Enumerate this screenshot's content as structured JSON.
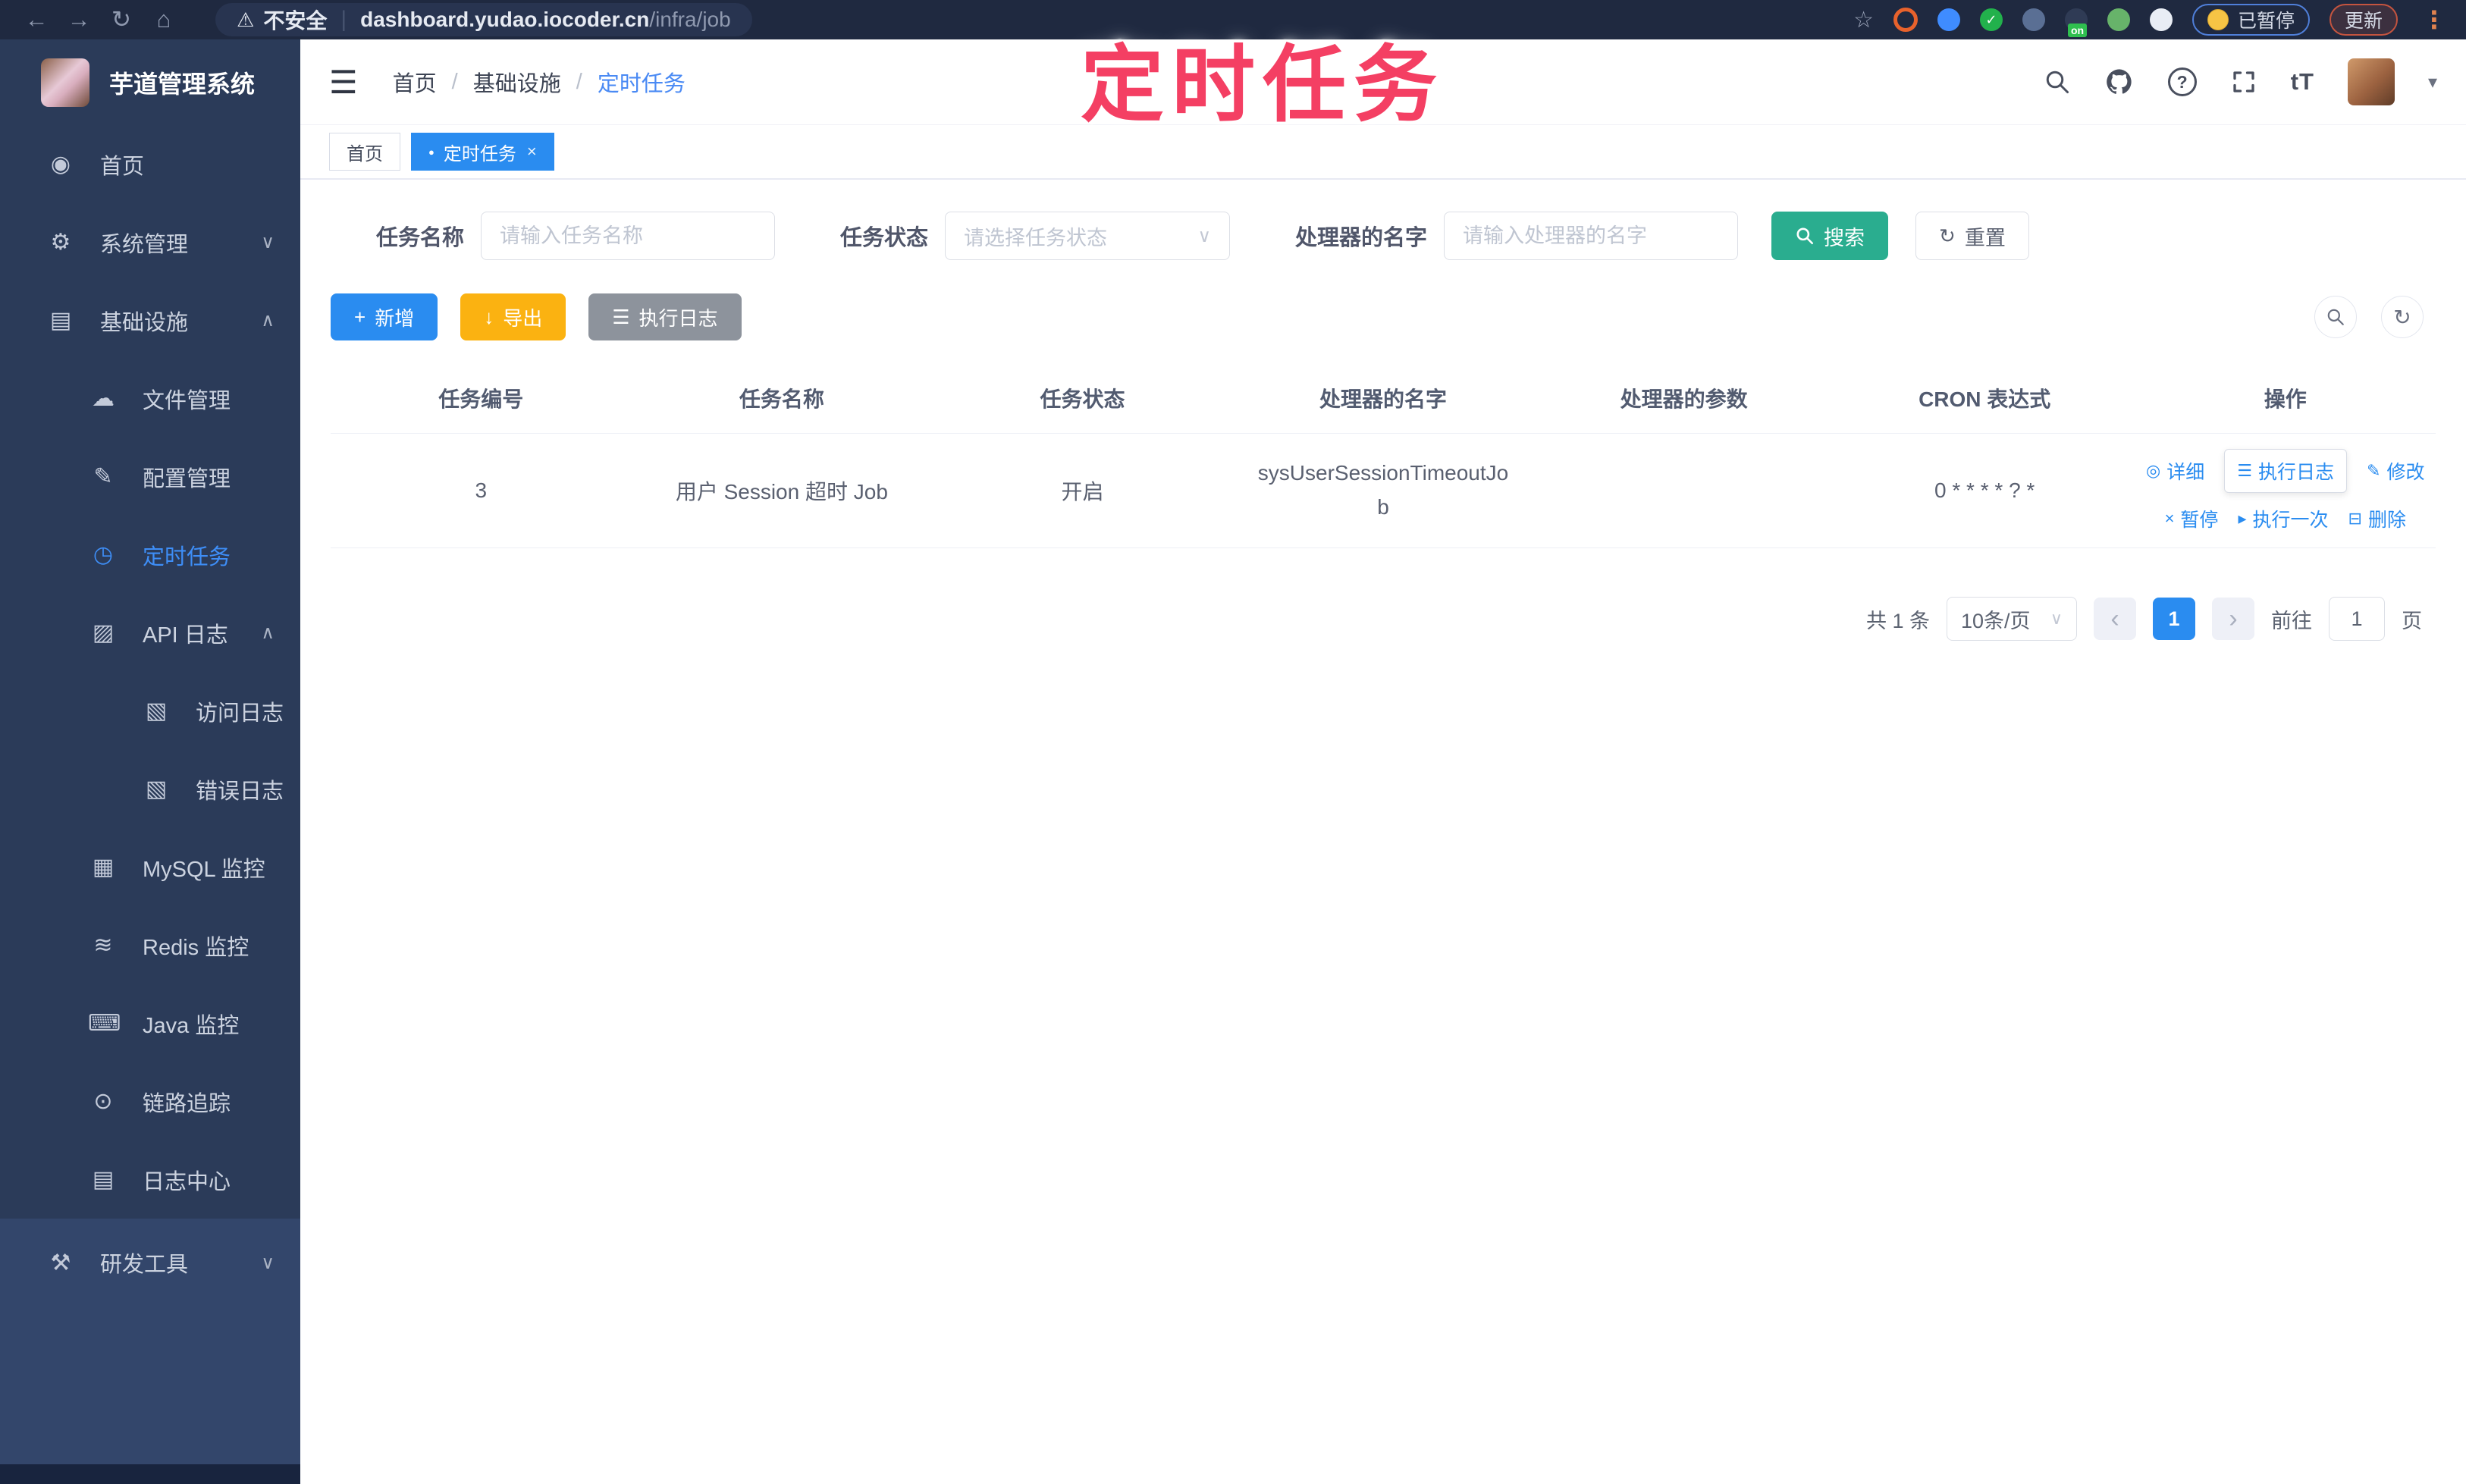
{
  "browser": {
    "security_label": "不安全",
    "url_host": "dashboard.yudao.iocoder.cn",
    "url_path": "/infra/job",
    "paused_label": "已暂停",
    "update_label": "更新",
    "on_badge": "on"
  },
  "annotation": {
    "text": "定时任务",
    "color": "#f43f63"
  },
  "sidebar": {
    "logo_title": "芋道管理系统",
    "items": [
      {
        "label": "首页"
      },
      {
        "label": "系统管理"
      },
      {
        "label": "基础设施"
      },
      {
        "label": "文件管理"
      },
      {
        "label": "配置管理"
      },
      {
        "label": "定时任务"
      },
      {
        "label": "API 日志"
      },
      {
        "label": "访问日志"
      },
      {
        "label": "错误日志"
      },
      {
        "label": "MySQL 监控"
      },
      {
        "label": "Redis 监控"
      },
      {
        "label": "Java 监控"
      },
      {
        "label": "链路追踪"
      },
      {
        "label": "日志中心"
      },
      {
        "label": "研发工具"
      }
    ]
  },
  "header": {
    "breadcrumb": [
      "首页",
      "基础设施",
      "定时任务"
    ],
    "font_size_icon": "tT",
    "question_mark": "?"
  },
  "tabs": [
    {
      "label": "首页"
    },
    {
      "label": "定时任务"
    }
  ],
  "filters": {
    "task_name": {
      "label": "任务名称",
      "placeholder": "请输入任务名称",
      "value": ""
    },
    "task_status": {
      "label": "任务状态",
      "placeholder": "请选择任务状态"
    },
    "handler_name": {
      "label": "处理器的名字",
      "placeholder": "请输入处理器的名字",
      "value": ""
    },
    "search_label": "搜索",
    "reset_label": "重置"
  },
  "toolbar": {
    "add_label": "新增",
    "export_label": "导出",
    "exec_log_label": "执行日志"
  },
  "table": {
    "columns": [
      "任务编号",
      "任务名称",
      "任务状态",
      "处理器的名字",
      "处理器的参数",
      "CRON 表达式",
      "操作"
    ],
    "rows": [
      {
        "id": "3",
        "name": "用户 Session 超时 Job",
        "status": "开启",
        "handler": "sysUserSessionTimeoutJob",
        "params": "",
        "cron": "0 * * * * ? *"
      }
    ],
    "actions": [
      {
        "label": "详细"
      },
      {
        "label": "执行日志"
      },
      {
        "label": "修改"
      },
      {
        "label": "暂停"
      },
      {
        "label": "执行一次"
      },
      {
        "label": "删除"
      }
    ]
  },
  "pagination": {
    "total": "共 1 条",
    "page_size": "10条/页",
    "current": "1",
    "goto_label": "前往",
    "goto_value": "1",
    "unit_label": "页"
  },
  "icons": {
    "back": "←",
    "forward": "→",
    "reload": "↻",
    "home": "⌂",
    "warning": "⚠",
    "bookmark_star": "☆",
    "menu_dots": "⋮",
    "hamburger": "☰",
    "breadcrumb_sep": "/",
    "caret_down": "▾",
    "check": "✓",
    "dashboard": "◉",
    "gear": "⚙",
    "infra": "▤",
    "cloud": "☁",
    "edit": "✎",
    "timer": "◷",
    "apilog": "▨",
    "doc": "▧",
    "mysql": "▦",
    "redis": "≋",
    "java": "⌨",
    "trace": "⊙",
    "logcenter": "▤",
    "tools": "⚒",
    "chev_down": "∨",
    "chev_up": "∧",
    "select_caret": "∨",
    "plus": "+",
    "download": "↓",
    "lines": "☰",
    "refresh": "↻",
    "eye": "◎",
    "pause": "×",
    "play": "▸",
    "delete": "⊟",
    "tab_dot": "●",
    "close": "×",
    "prev": "‹",
    "next": "›"
  },
  "colors": {
    "accent_blue": "#2a8cf0",
    "search_teal": "#2aad8f",
    "export_amber": "#fbb211",
    "exec_gray": "#8d939c",
    "sidebar_bg": "#2b3b59",
    "active_link": "#3e8ef7",
    "annotation_pink": "#f43f63"
  }
}
